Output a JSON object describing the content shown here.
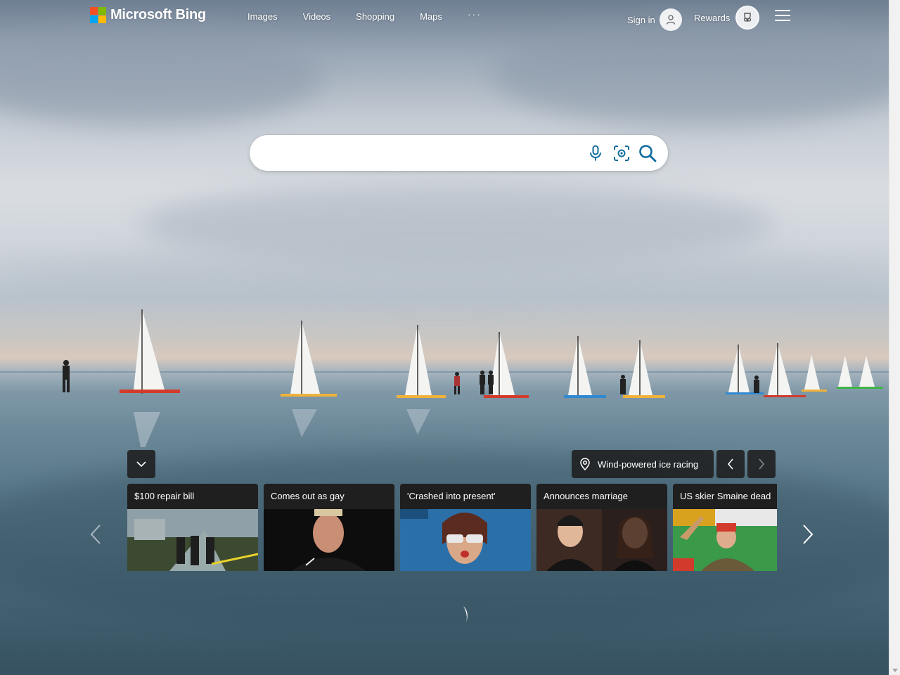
{
  "header": {
    "brand": "Microsoft Bing",
    "nav": [
      {
        "label": "Images"
      },
      {
        "label": "Videos"
      },
      {
        "label": "Shopping"
      },
      {
        "label": "Maps"
      },
      {
        "label": "···"
      }
    ],
    "signin_label": "Sign in",
    "rewards_label": "Rewards",
    "icons": [
      "user-icon",
      "rewards-trophy-icon",
      "menu-icon"
    ]
  },
  "search": {
    "value": "",
    "placeholder": "",
    "icons": [
      "microphone-icon",
      "visual-search-icon",
      "search-icon"
    ]
  },
  "image_caption": {
    "text": "Wind-powered ice racing",
    "icon": "location-pin-icon"
  },
  "news": {
    "cards": [
      {
        "title": "$100 repair bill"
      },
      {
        "title": "Comes out as gay"
      },
      {
        "title": "'Crashed into present'"
      },
      {
        "title": "Announces marriage"
      },
      {
        "title": "US skier Smaine dead"
      }
    ]
  },
  "colors": {
    "accent": "#0f6c9e",
    "panel": "#1e1e1e",
    "logo_red": "#f25022",
    "logo_green": "#7fba00",
    "logo_blue": "#00a4ef",
    "logo_yellow": "#ffb900"
  }
}
